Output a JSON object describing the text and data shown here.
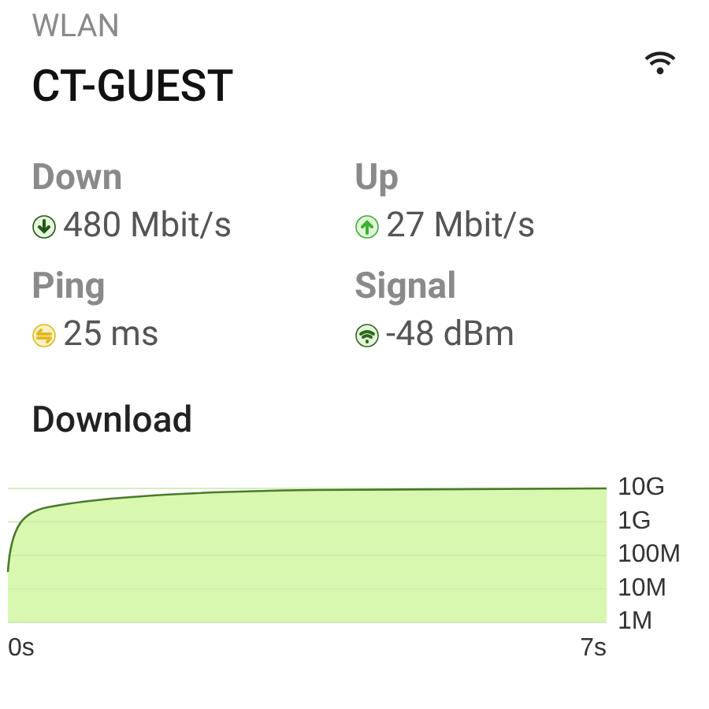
{
  "header": {
    "category": "WLAN",
    "network": "CT-GUEST"
  },
  "stats": [
    {
      "label": "Down",
      "value": "480 Mbit/s",
      "kind": "down"
    },
    {
      "label": "Up",
      "value": "27 Mbit/s",
      "kind": "up"
    },
    {
      "label": "Ping",
      "value": "25 ms",
      "kind": "ping"
    },
    {
      "label": "Signal",
      "value": "-48 dBm",
      "kind": "signal"
    }
  ],
  "download": {
    "title": "Download",
    "y_axis_labels": [
      "10G",
      "1G",
      "100M",
      "10M",
      "1M"
    ],
    "x_axis_labels": [
      "0s",
      "7s"
    ]
  }
}
